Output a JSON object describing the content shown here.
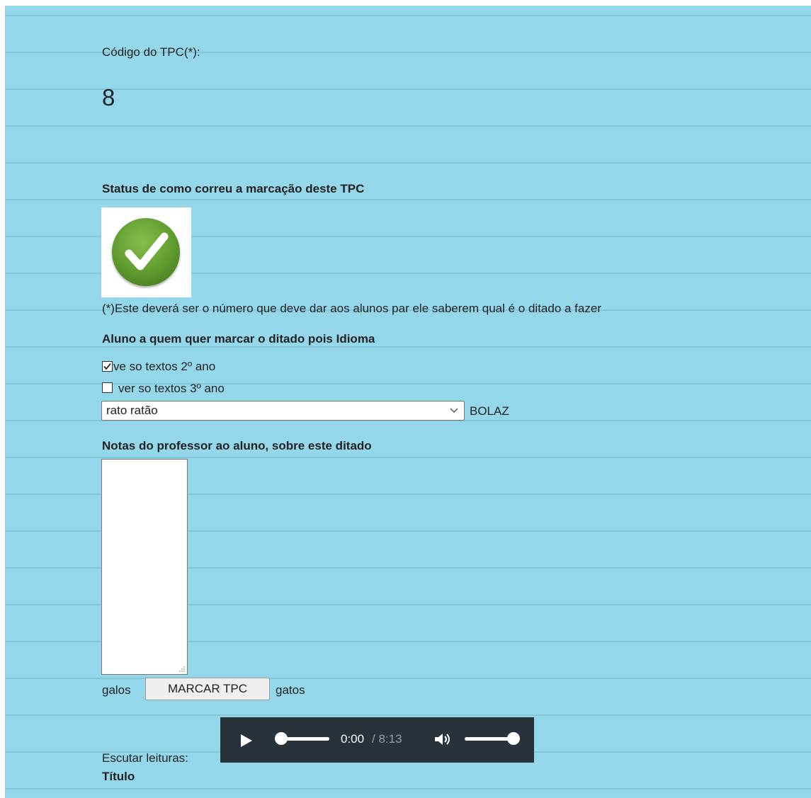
{
  "code": {
    "label": "Código do TPC(*):",
    "value": "8"
  },
  "status": {
    "heading": "Status de como correu a marcação deste TPC",
    "icon": "green-check-icon",
    "note": "(*)Este deverá ser o número que deve dar aos alunos par ele saberem qual é o ditado a fazer"
  },
  "student": {
    "heading": "Aluno a quem quer marcar o ditado pois Idioma",
    "checkbox_2": {
      "label": "ve so textos 2º ano",
      "checked": true
    },
    "checkbox_3": {
      "label": "ver so textos 3º ano",
      "checked": false
    },
    "select_value": "rato ratão",
    "select_suffix": "BOLAZ"
  },
  "notes": {
    "heading": "Notas do professor ao aluno, sobre este ditado",
    "value": ""
  },
  "actions": {
    "before": "galos",
    "button": "MARCAR TPC",
    "after": "gatos"
  },
  "audio": {
    "label": "Escutar leituras:",
    "current": "0:00",
    "duration": "/ 8:13",
    "progress": 0,
    "volume": 1
  },
  "table": {
    "title_header": "Título"
  },
  "colors": {
    "background": "#95d7ea",
    "player": "#27323a",
    "check": "#5f9a2e"
  }
}
